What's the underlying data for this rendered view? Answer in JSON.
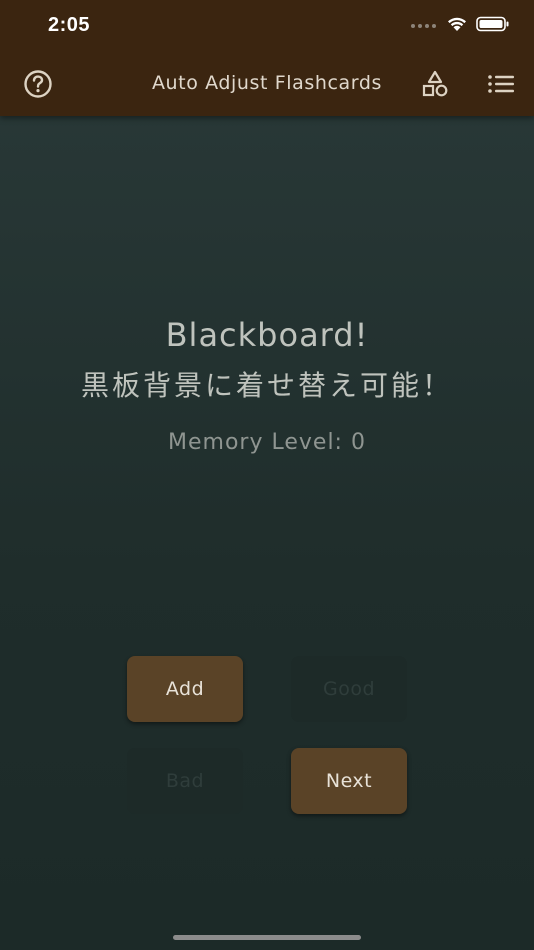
{
  "status_bar": {
    "time": "2:05"
  },
  "nav": {
    "title": "Auto Adjust Flashcards",
    "left_icon": "help-circle-icon",
    "right_icons": [
      "shapes-icon",
      "list-icon"
    ]
  },
  "card": {
    "line1": "Blackboard!",
    "line2": "黒板背景に着せ替え可能！",
    "memory_level": "Memory Level: 0"
  },
  "buttons": {
    "add": "Add",
    "good": "Good",
    "bad": "Bad",
    "next": "Next"
  },
  "colors": {
    "header": "#3b2510",
    "background": "#26312f",
    "button_active": "#5a4327",
    "button_disabled": "#1d2a28"
  }
}
